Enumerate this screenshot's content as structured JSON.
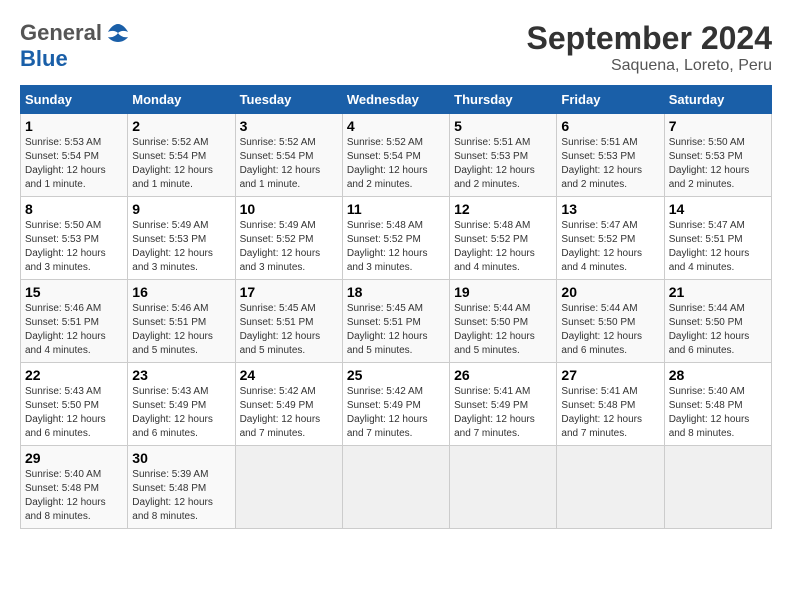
{
  "header": {
    "logo_general": "General",
    "logo_blue": "Blue",
    "month_title": "September 2024",
    "subtitle": "Saquena, Loreto, Peru"
  },
  "days_of_week": [
    "Sunday",
    "Monday",
    "Tuesday",
    "Wednesday",
    "Thursday",
    "Friday",
    "Saturday"
  ],
  "weeks": [
    [
      {
        "day": "1",
        "info": "Sunrise: 5:53 AM\nSunset: 5:54 PM\nDaylight: 12 hours\nand 1 minute."
      },
      {
        "day": "2",
        "info": "Sunrise: 5:52 AM\nSunset: 5:54 PM\nDaylight: 12 hours\nand 1 minute."
      },
      {
        "day": "3",
        "info": "Sunrise: 5:52 AM\nSunset: 5:54 PM\nDaylight: 12 hours\nand 1 minute."
      },
      {
        "day": "4",
        "info": "Sunrise: 5:52 AM\nSunset: 5:54 PM\nDaylight: 12 hours\nand 2 minutes."
      },
      {
        "day": "5",
        "info": "Sunrise: 5:51 AM\nSunset: 5:53 PM\nDaylight: 12 hours\nand 2 minutes."
      },
      {
        "day": "6",
        "info": "Sunrise: 5:51 AM\nSunset: 5:53 PM\nDaylight: 12 hours\nand 2 minutes."
      },
      {
        "day": "7",
        "info": "Sunrise: 5:50 AM\nSunset: 5:53 PM\nDaylight: 12 hours\nand 2 minutes."
      }
    ],
    [
      {
        "day": "8",
        "info": "Sunrise: 5:50 AM\nSunset: 5:53 PM\nDaylight: 12 hours\nand 3 minutes."
      },
      {
        "day": "9",
        "info": "Sunrise: 5:49 AM\nSunset: 5:53 PM\nDaylight: 12 hours\nand 3 minutes."
      },
      {
        "day": "10",
        "info": "Sunrise: 5:49 AM\nSunset: 5:52 PM\nDaylight: 12 hours\nand 3 minutes."
      },
      {
        "day": "11",
        "info": "Sunrise: 5:48 AM\nSunset: 5:52 PM\nDaylight: 12 hours\nand 3 minutes."
      },
      {
        "day": "12",
        "info": "Sunrise: 5:48 AM\nSunset: 5:52 PM\nDaylight: 12 hours\nand 4 minutes."
      },
      {
        "day": "13",
        "info": "Sunrise: 5:47 AM\nSunset: 5:52 PM\nDaylight: 12 hours\nand 4 minutes."
      },
      {
        "day": "14",
        "info": "Sunrise: 5:47 AM\nSunset: 5:51 PM\nDaylight: 12 hours\nand 4 minutes."
      }
    ],
    [
      {
        "day": "15",
        "info": "Sunrise: 5:46 AM\nSunset: 5:51 PM\nDaylight: 12 hours\nand 4 minutes."
      },
      {
        "day": "16",
        "info": "Sunrise: 5:46 AM\nSunset: 5:51 PM\nDaylight: 12 hours\nand 5 minutes."
      },
      {
        "day": "17",
        "info": "Sunrise: 5:45 AM\nSunset: 5:51 PM\nDaylight: 12 hours\nand 5 minutes."
      },
      {
        "day": "18",
        "info": "Sunrise: 5:45 AM\nSunset: 5:51 PM\nDaylight: 12 hours\nand 5 minutes."
      },
      {
        "day": "19",
        "info": "Sunrise: 5:44 AM\nSunset: 5:50 PM\nDaylight: 12 hours\nand 5 minutes."
      },
      {
        "day": "20",
        "info": "Sunrise: 5:44 AM\nSunset: 5:50 PM\nDaylight: 12 hours\nand 6 minutes."
      },
      {
        "day": "21",
        "info": "Sunrise: 5:44 AM\nSunset: 5:50 PM\nDaylight: 12 hours\nand 6 minutes."
      }
    ],
    [
      {
        "day": "22",
        "info": "Sunrise: 5:43 AM\nSunset: 5:50 PM\nDaylight: 12 hours\nand 6 minutes."
      },
      {
        "day": "23",
        "info": "Sunrise: 5:43 AM\nSunset: 5:49 PM\nDaylight: 12 hours\nand 6 minutes."
      },
      {
        "day": "24",
        "info": "Sunrise: 5:42 AM\nSunset: 5:49 PM\nDaylight: 12 hours\nand 7 minutes."
      },
      {
        "day": "25",
        "info": "Sunrise: 5:42 AM\nSunset: 5:49 PM\nDaylight: 12 hours\nand 7 minutes."
      },
      {
        "day": "26",
        "info": "Sunrise: 5:41 AM\nSunset: 5:49 PM\nDaylight: 12 hours\nand 7 minutes."
      },
      {
        "day": "27",
        "info": "Sunrise: 5:41 AM\nSunset: 5:48 PM\nDaylight: 12 hours\nand 7 minutes."
      },
      {
        "day": "28",
        "info": "Sunrise: 5:40 AM\nSunset: 5:48 PM\nDaylight: 12 hours\nand 8 minutes."
      }
    ],
    [
      {
        "day": "29",
        "info": "Sunrise: 5:40 AM\nSunset: 5:48 PM\nDaylight: 12 hours\nand 8 minutes."
      },
      {
        "day": "30",
        "info": "Sunrise: 5:39 AM\nSunset: 5:48 PM\nDaylight: 12 hours\nand 8 minutes."
      },
      {
        "day": "",
        "info": ""
      },
      {
        "day": "",
        "info": ""
      },
      {
        "day": "",
        "info": ""
      },
      {
        "day": "",
        "info": ""
      },
      {
        "day": "",
        "info": ""
      }
    ]
  ]
}
